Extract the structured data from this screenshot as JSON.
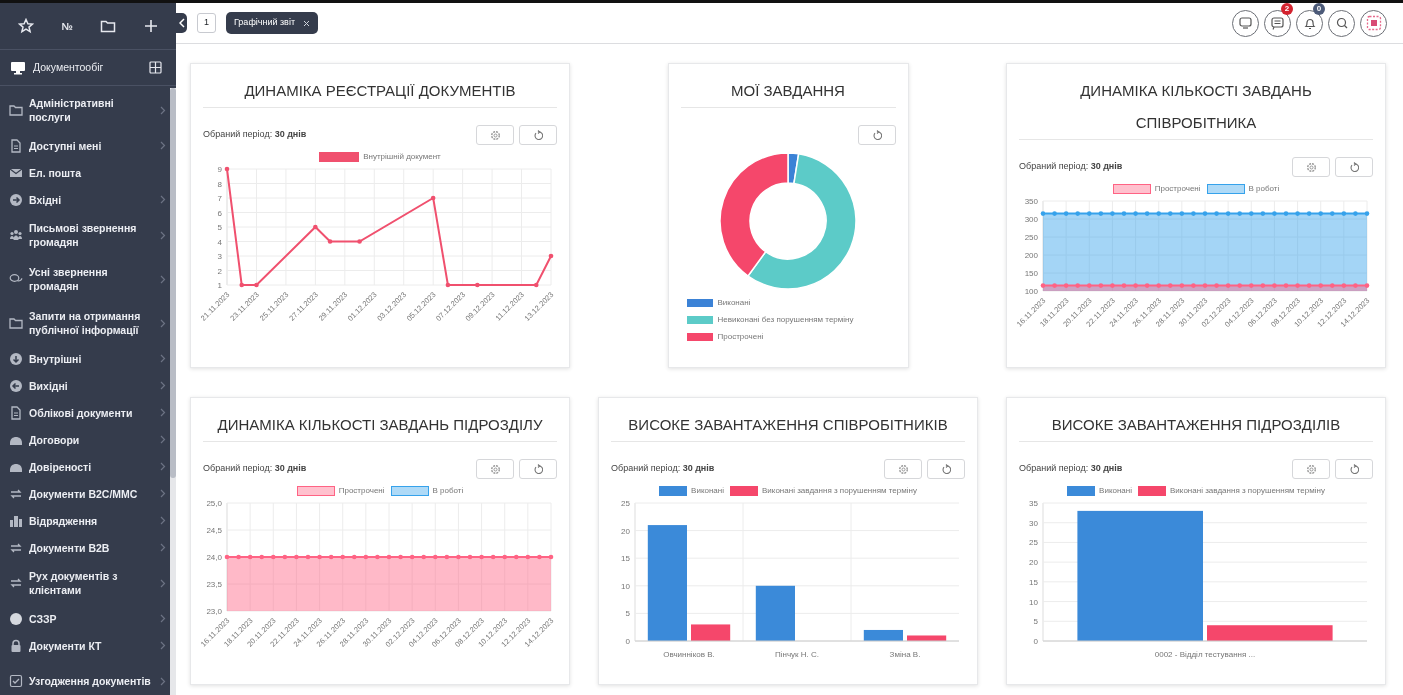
{
  "sidebar": {
    "quick_button": "№",
    "module": "Документообіг",
    "items": [
      {
        "label": "Адміністративні послуги",
        "expandable": true
      },
      {
        "label": "Доступні мені",
        "expandable": true
      },
      {
        "label": "Ел. пошта",
        "expandable": false
      },
      {
        "label": "Вхідні",
        "expandable": true
      },
      {
        "label": "Письмові звернення громадян",
        "expandable": true
      },
      {
        "label": "Усні звернення громадян",
        "expandable": true
      },
      {
        "label": "Запити на отримання публічної інформації",
        "expandable": true
      },
      {
        "label": "Внутрішні",
        "expandable": true
      },
      {
        "label": "Вихідні",
        "expandable": true
      },
      {
        "label": "Облікові документи",
        "expandable": true
      },
      {
        "label": "Договори",
        "expandable": true
      },
      {
        "label": "Довіреності",
        "expandable": true
      },
      {
        "label": "Документи B2C/MMC",
        "expandable": true
      },
      {
        "label": "Відрядження",
        "expandable": true
      },
      {
        "label": "Документи B2B",
        "expandable": true
      },
      {
        "label": "Рух документів з клієнтами",
        "expandable": true
      },
      {
        "label": "СЗЗР",
        "expandable": true
      },
      {
        "label": "Документи КТ",
        "expandable": true
      },
      {
        "label": "Узгодження документів",
        "expandable": true
      }
    ]
  },
  "tabbar": {
    "counter": "1",
    "tabs": [
      {
        "label": "Графічний звіт",
        "selected": true
      }
    ]
  },
  "header": {
    "messages_badge": "2",
    "alerts_badge": "0"
  },
  "widgets": [
    {
      "kind": "chart",
      "title": "ДИНАМІКА РЕЄСТРАЦІЇ ДОКУМЕНТІВ",
      "period": "Обраний період: **30 днів**",
      "has_settings": true,
      "chart_data": {
        "type": "line",
        "grid": true,
        "categories": [
          "21.11.2023",
          null,
          "23.11.2023",
          null,
          "25.11.2023",
          null,
          "27.11.2023",
          null,
          "29.11.2023",
          null,
          "01.12.2023",
          null,
          "03.12.2023",
          null,
          "05.12.2023",
          null,
          "07.12.2023",
          null,
          "09.12.2023",
          null,
          "11.12.2023",
          null,
          "13.12.2023"
        ],
        "ylim": [
          1,
          9
        ],
        "yticks": [
          1,
          2,
          3,
          4,
          5,
          6,
          7,
          8,
          9
        ],
        "series": [
          {
            "name": "Внутрішній документ",
            "color": "#f0506e",
            "values": [
              9,
              1,
              1,
              null,
              null,
              null,
              5,
              4,
              null,
              4,
              null,
              null,
              null,
              null,
              7,
              1,
              null,
              1,
              null,
              null,
              null,
              1,
              3
            ]
          }
        ]
      }
    },
    {
      "kind": "tasks",
      "title": "МОЇ ЗАВДАННЯ",
      "has_settings": false,
      "legend": [
        {
          "label": "Виконані",
          "color": "#3b82d6"
        },
        {
          "label": "Невиконані без порушенням терміну",
          "color": "#5ccbc8"
        },
        {
          "label": "Прострочені",
          "color": "#f5476b"
        }
      ]
    },
    {
      "kind": "chart",
      "title": "ДИНАМІКА КІЛЬКОСТІ ЗАВДАНЬ СПІВРОБІТНИКА",
      "period": "Обраний період: **30 днів**",
      "has_settings": true,
      "chart_data": {
        "type": "area",
        "grid": true,
        "categories": [
          "16.11.2023",
          null,
          "18.11.2023",
          null,
          "20.11.2023",
          null,
          "22.11.2023",
          null,
          "24.11.2023",
          null,
          "26.11.2023",
          null,
          "28.11.2023",
          null,
          "30.11.2023",
          null,
          "02.12.2023",
          null,
          "04.12.2023",
          null,
          "06.12.2023",
          null,
          "08.12.2023",
          null,
          "10.12.2023",
          null,
          "12.12.2023",
          null,
          "14.12.2023"
        ],
        "ylim": [
          100,
          350
        ],
        "yticks": [
          100,
          150,
          200,
          250,
          300,
          350
        ],
        "series": [
          {
            "name": "Прострочені",
            "color": "#ff6384",
            "values": [
              115,
              115,
              115,
              115,
              115,
              115,
              115,
              115,
              115,
              115,
              115,
              115,
              115,
              115,
              115,
              115,
              115,
              115,
              115,
              115,
              115,
              115,
              115,
              115,
              115,
              115,
              115,
              115,
              115
            ]
          },
          {
            "name": "В роботі",
            "color": "#36a2eb",
            "values": [
              315,
              315,
              315,
              315,
              315,
              315,
              315,
              315,
              315,
              315,
              315,
              315,
              315,
              315,
              315,
              315,
              315,
              315,
              315,
              315,
              315,
              315,
              315,
              315,
              315,
              315,
              315,
              315,
              315
            ]
          }
        ]
      }
    },
    {
      "kind": "chart",
      "title": "ДИНАМІКА КІЛЬКОСТІ ЗАВДАНЬ ПІДРОЗДІЛУ",
      "period": "Обраний період: **30 днів**",
      "has_settings": true,
      "chart_data": {
        "type": "area",
        "grid": true,
        "categories": [
          "16.11.2023",
          null,
          "18.11.2023",
          null,
          "20.11.2023",
          null,
          "22.11.2023",
          null,
          "24.11.2023",
          null,
          "26.11.2023",
          null,
          "28.11.2023",
          null,
          "30.11.2023",
          null,
          "02.12.2023",
          null,
          "04.12.2023",
          null,
          "06.12.2023",
          null,
          "08.12.2023",
          null,
          "10.12.2023",
          null,
          "12.12.2023",
          null,
          "14.12.2023"
        ],
        "ylim": [
          23,
          25
        ],
        "yticks": [
          {
            "value": 23,
            "label": "23,0"
          },
          {
            "value": 23.5,
            "label": "23,5"
          },
          {
            "value": 24,
            "label": "24,0"
          },
          {
            "value": 24.5,
            "label": "24,5"
          },
          {
            "value": 25,
            "label": "25,0"
          }
        ],
        "series": [
          {
            "name": "Прострочені",
            "color": "#ff6384",
            "values": [
              24,
              24,
              24,
              24,
              24,
              24,
              24,
              24,
              24,
              24,
              24,
              24,
              24,
              24,
              24,
              24,
              24,
              24,
              24,
              24,
              24,
              24,
              24,
              24,
              24,
              24,
              24,
              24,
              24
            ]
          },
          {
            "name": "В роботі",
            "color": "#36a2eb",
            "values": [
              null,
              null,
              null,
              null,
              null,
              null,
              null,
              null,
              null,
              null,
              null,
              null,
              null,
              null,
              null,
              null,
              null,
              null,
              null,
              null,
              null,
              null,
              null,
              null,
              null,
              null,
              null,
              null,
              null
            ]
          }
        ]
      }
    },
    {
      "kind": "chart",
      "title": "ВИСОКЕ ЗАВАНТАЖЕННЯ СПІВРОБІТНИКІВ",
      "period": "Обраний період: **30 днів**",
      "has_settings": true,
      "chart_data": {
        "type": "bar",
        "grid": true,
        "categories": [
          "Овчинніков В.",
          "Пінчук Н. С.",
          "Зміна В."
        ],
        "ylim": [
          0,
          25
        ],
        "yticks": [
          0,
          5,
          10,
          15,
          20,
          25
        ],
        "series": [
          {
            "name": "Виконані",
            "color": "#3b8ad9",
            "values": [
              21,
              10,
              2
            ]
          },
          {
            "name": "Виконані завдання з порушенням терміну",
            "color": "#f5476b",
            "values": [
              3,
              0,
              1
            ]
          }
        ]
      }
    },
    {
      "kind": "chart",
      "title": "ВИСОКЕ ЗАВАНТАЖЕННЯ ПІДРОЗДІЛІВ",
      "period": "Обраний період: **30 днів**",
      "has_settings": true,
      "chart_data": {
        "type": "bar",
        "grid": true,
        "categories": [
          "0002 - Відділ тестування ..."
        ],
        "ylim": [
          0,
          35
        ],
        "yticks": [
          0,
          5,
          10,
          15,
          20,
          25,
          30,
          35
        ],
        "series": [
          {
            "name": "Виконані",
            "color": "#3b8ad9",
            "values": [
              33
            ]
          },
          {
            "name": "Виконані завдання з порушенням терміну",
            "color": "#f5476b",
            "values": [
              4
            ]
          }
        ]
      }
    }
  ]
}
